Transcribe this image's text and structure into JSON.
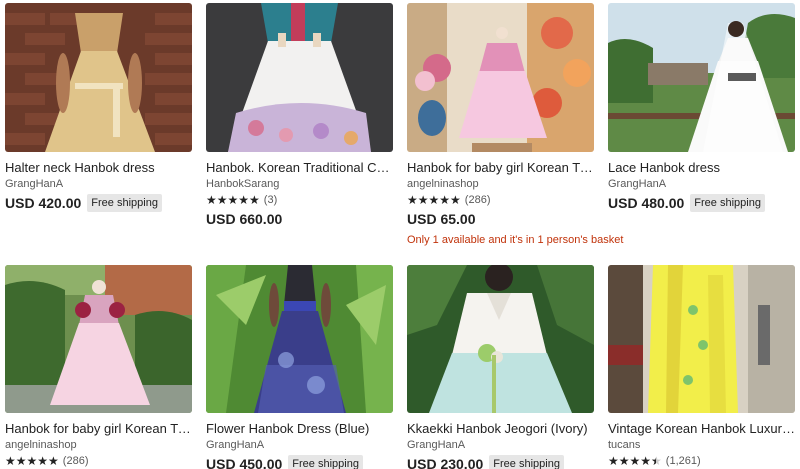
{
  "listings": [
    {
      "title": "Halter neck Hanbok dress",
      "shop": "GrangHanA",
      "stars": "",
      "count": "",
      "price": "USD 420.00",
      "badge": "Free shipping",
      "note": ""
    },
    {
      "title": "Hanbok. Korean Traditional Costume",
      "shop": "HanbokSarang",
      "stars": "★★★★★",
      "count": "(3)",
      "price": "USD 660.00",
      "badge": "",
      "note": ""
    },
    {
      "title": "Hanbok for baby girl Korean Traditional",
      "shop": "angelninashop",
      "stars": "★★★★★",
      "count": "(286)",
      "price": "USD 65.00",
      "badge": "",
      "note": "Only 1 available and it's in 1 person's basket"
    },
    {
      "title": "Lace Hanbok dress",
      "shop": "GrangHanA",
      "stars": "",
      "count": "",
      "price": "USD 480.00",
      "badge": "Free shipping",
      "note": ""
    },
    {
      "title": "Hanbok for baby girl Korean Traditional",
      "shop": "angelninashop",
      "stars": "★★★★★",
      "count": "(286)",
      "price": "",
      "badge": "",
      "note": ""
    },
    {
      "title": "Flower Hanbok Dress (Blue)",
      "shop": "GrangHanA",
      "stars": "",
      "count": "",
      "price": "USD 450.00",
      "badge": "Free shipping",
      "note": ""
    },
    {
      "title": "Kkaekki Hanbok Jeogori (Ivory)",
      "shop": "GrangHanA",
      "stars": "",
      "count": "",
      "price": "USD 230.00",
      "badge": "Free shipping",
      "note": ""
    },
    {
      "title": "Vintage Korean Hanbok Luxury Korean",
      "shop": "tucans",
      "stars": "★★★★",
      "count": "(1,261)",
      "price": "",
      "badge": "",
      "note": ""
    }
  ]
}
